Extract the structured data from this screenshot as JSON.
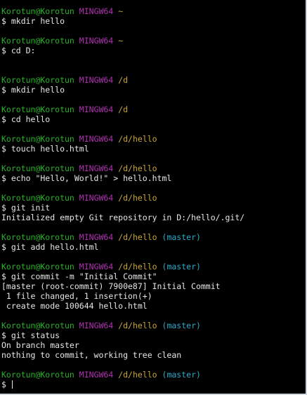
{
  "colors": {
    "background": "#000000",
    "user": "#28b228",
    "host": "#b030b0",
    "path": "#c9a530",
    "branch": "#2aa9c9",
    "text": "#e6e6e6"
  },
  "blocks": [
    {
      "user": "Korotun@Korotun",
      "host": "MINGW64",
      "path": "~",
      "branch": "",
      "cmd": "$ mkdir hello",
      "output": [],
      "blank_after": 1
    },
    {
      "user": "Korotun@Korotun",
      "host": "MINGW64",
      "path": "~",
      "branch": "",
      "cmd": "$ cd D:",
      "output": [],
      "blank_after": 2
    },
    {
      "user": "Korotun@Korotun",
      "host": "MINGW64",
      "path": "/d",
      "branch": "",
      "cmd": "$ mkdir hello",
      "output": [],
      "blank_after": 1
    },
    {
      "user": "Korotun@Korotun",
      "host": "MINGW64",
      "path": "/d",
      "branch": "",
      "cmd": "$ cd hello",
      "output": [],
      "blank_after": 1
    },
    {
      "user": "Korotun@Korotun",
      "host": "MINGW64",
      "path": "/d/hello",
      "branch": "",
      "cmd": "$ touch hello.html",
      "output": [],
      "blank_after": 1
    },
    {
      "user": "Korotun@Korotun",
      "host": "MINGW64",
      "path": "/d/hello",
      "branch": "",
      "cmd": "$ echo \"Hello, World!\" > hello.html",
      "output": [],
      "blank_after": 1
    },
    {
      "user": "Korotun@Korotun",
      "host": "MINGW64",
      "path": "/d/hello",
      "branch": "",
      "cmd": "$ git init",
      "output": [
        "Initialized empty Git repository in D:/hello/.git/"
      ],
      "blank_after": 1
    },
    {
      "user": "Korotun@Korotun",
      "host": "MINGW64",
      "path": "/d/hello",
      "branch": "(master)",
      "cmd": "$ git add hello.html",
      "output": [],
      "blank_after": 1
    },
    {
      "user": "Korotun@Korotun",
      "host": "MINGW64",
      "path": "/d/hello",
      "branch": "(master)",
      "cmd": "$ git commit -m \"Initial Commit\"",
      "output": [
        "[master (root-commit) 7900e87] Initial Commit",
        " 1 file changed, 1 insertion(+)",
        " create mode 100644 hello.html"
      ],
      "blank_after": 1
    },
    {
      "user": "Korotun@Korotun",
      "host": "MINGW64",
      "path": "/d/hello",
      "branch": "(master)",
      "cmd": "$ git status",
      "output": [
        "On branch master",
        "nothing to commit, working tree clean"
      ],
      "blank_after": 1
    },
    {
      "user": "Korotun@Korotun",
      "host": "MINGW64",
      "path": "/d/hello",
      "branch": "(master)",
      "cmd": "$ ",
      "output": [],
      "blank_after": 0,
      "has_cursor": true
    }
  ]
}
